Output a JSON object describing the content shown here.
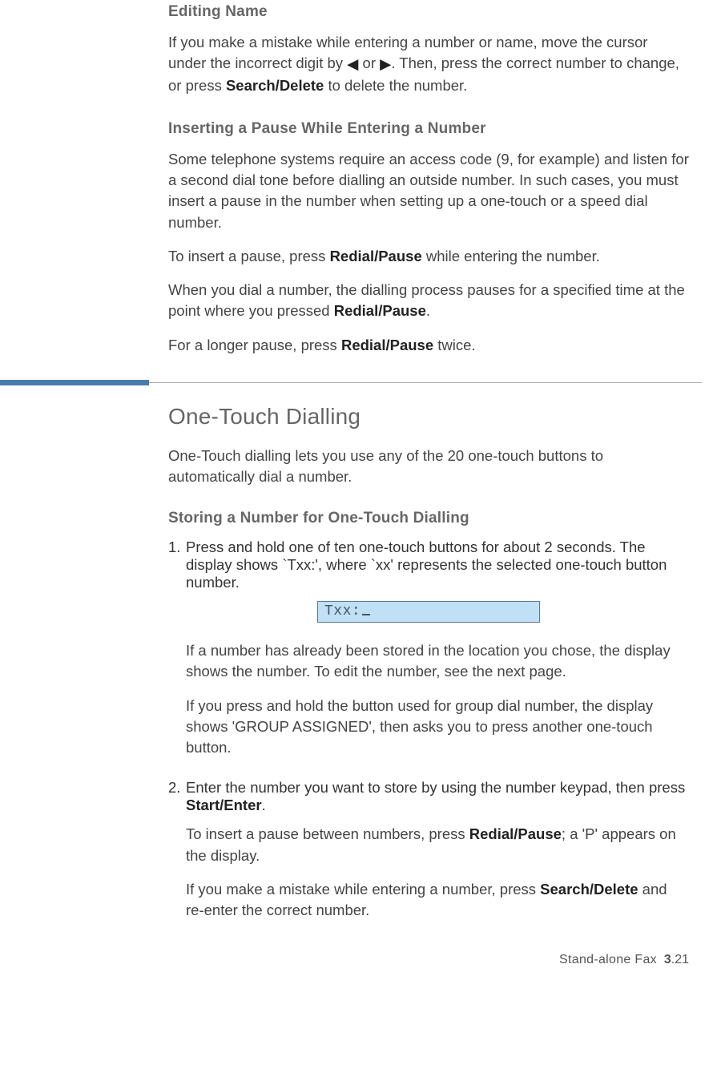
{
  "sections": {
    "editing_name": {
      "heading": "Editing Name",
      "p1_a": "If you make a mistake while entering a number or name, move the cursor under the incorrect digit by ",
      "p1_or": " or ",
      "p1_b": ". Then, press the correct number to change, or press ",
      "p1_bold": "Search/Delete",
      "p1_c": " to delete the number."
    },
    "pause": {
      "heading": "Inserting a Pause While Entering a Number",
      "p1": "Some telephone systems require an access code (9, for example) and listen for a second dial tone before dialling an outside number. In such cases, you must insert a pause in the number when setting up a one-touch or a speed dial number.",
      "p2_a": "To insert a pause, press ",
      "p2_bold": "Redial/Pause",
      "p2_b": " while entering the number.",
      "p3_a": "When you dial a number, the dialling process pauses for a specified time at the point where you pressed ",
      "p3_bold": "Redial/Pause",
      "p3_b": ".",
      "p4_a": "For a longer pause, press ",
      "p4_bold": "Redial/Pause",
      "p4_b": " twice."
    },
    "one_touch": {
      "heading": "One-Touch Dialling",
      "intro": "One-Touch dialling lets you use any of the 20 one-touch buttons to automatically dial a number.",
      "storing_heading": "Storing a Number for One-Touch Dialling",
      "step1_num": "1. ",
      "step1": "Press and hold one of ten one-touch buttons for about 2 seconds. The display shows `Txx:', where `xx' represents the selected one-touch button number.",
      "lcd": "Txx:",
      "step1_sub1": "If a number has already been stored in the location you chose, the display shows the number. To edit the number, see the next page.",
      "step1_sub2": "If you press and hold the button used for group dial number, the display shows 'GROUP ASSIGNED', then asks you to press another one-touch button.",
      "step2_num": "2. ",
      "step2_a": "Enter the number you want to store by using the number keypad, then press ",
      "step2_bold": "Start/Enter",
      "step2_b": ".",
      "step2_sub1_a": "To insert a pause between numbers, press ",
      "step2_sub1_bold": "Redial/Pause",
      "step2_sub1_b": "; a 'P' appears on the display.",
      "step2_sub2_a": "If you make a mistake while entering a number, press ",
      "step2_sub2_bold": "Search/Delete",
      "step2_sub2_b": " and re-enter the correct number."
    }
  },
  "footer": {
    "label": "Stand-alone Fax",
    "chapter": "3",
    "page": ".21"
  }
}
